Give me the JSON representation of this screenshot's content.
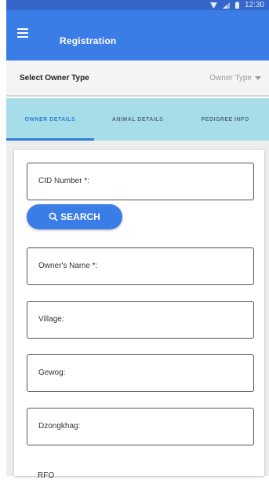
{
  "status_bar": {
    "time": "12:30",
    "icons": [
      "wifi-icon",
      "signal-icon",
      "battery-icon"
    ]
  },
  "app_bar": {
    "title": "Registration",
    "menu_icon": "hamburger-menu-icon"
  },
  "owner_type": {
    "label": "Select Owner Type",
    "placeholder": "Owner Type"
  },
  "tabs": [
    {
      "label": "OWNER DETAILS",
      "active": true
    },
    {
      "label": "ANIMAL DETAILS",
      "active": false
    },
    {
      "label": "PEDIGREE INFO",
      "active": false
    }
  ],
  "form": {
    "cid_label": "CID Number *:",
    "search_label": "SEARCH",
    "owner_name_label": "Owner's Name *:",
    "village_label": "Village:",
    "gewog_label": "Gewog:",
    "dzongkhag_label": "Dzongkhag:",
    "next_label_partial": "RFO"
  },
  "colors": {
    "primary": "#3b7de6",
    "status_bar": "#3566c9",
    "tab_bg": "#a7dde9",
    "tab_active": "#2f7fd6"
  }
}
